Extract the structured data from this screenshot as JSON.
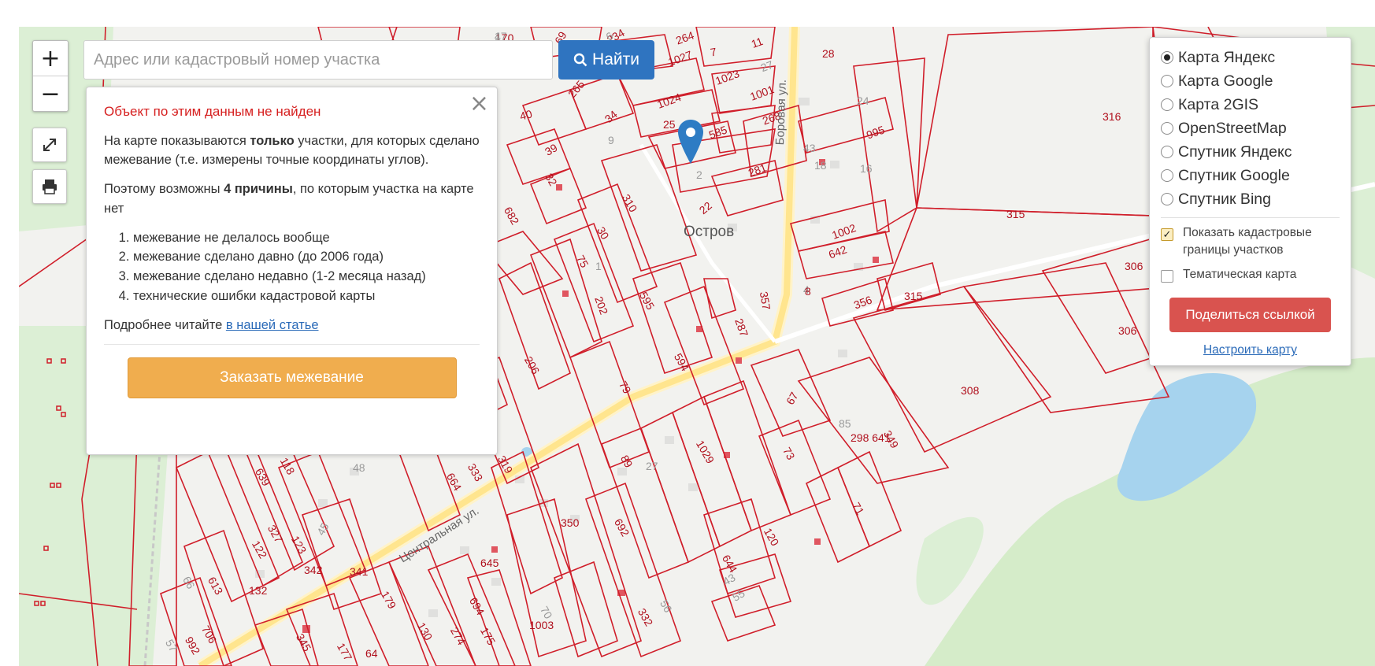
{
  "map": {
    "place_label": "Остров",
    "streets": [
      "Боровая ул.",
      "Центральная ул."
    ],
    "plots": [
      "17",
      "234",
      "264",
      "11",
      "69",
      "7",
      "28",
      "1027",
      "27",
      "1023",
      "1001",
      "1024",
      "268",
      "265",
      "40",
      "34",
      "9",
      "24",
      "316",
      "25",
      "585",
      "995",
      "43",
      "281",
      "18",
      "16",
      "39",
      "2",
      "32",
      "310",
      "22",
      "315",
      "1002",
      "642",
      "682",
      "30",
      "75",
      "1",
      "306",
      "356",
      "315",
      "357",
      "4",
      "306",
      "202",
      "595",
      "287",
      "206",
      "594",
      "308",
      "79",
      "67",
      "298 641",
      "89",
      "1029",
      "73",
      "349",
      "71",
      "48",
      "664",
      "333",
      "319",
      "639",
      "118",
      "27",
      "692",
      "45",
      "327",
      "122",
      "123",
      "120",
      "350",
      "644",
      "645",
      "43",
      "55",
      "341",
      "342",
      "56",
      "66",
      "613",
      "132",
      "694",
      "70",
      "179",
      "332",
      "992",
      "706",
      "345",
      "130",
      "274",
      "1003",
      "175",
      "57",
      "177",
      "64",
      "170",
      "85",
      "8",
      "5",
      "4",
      "6"
    ]
  },
  "zoom": {
    "plus": "+",
    "minus": "−"
  },
  "tools": {
    "fullscreen_icon": "fullscreen-icon",
    "print_icon": "printer-icon"
  },
  "search": {
    "placeholder": "Адрес или кадастровый номер участка",
    "button_label": "Найти"
  },
  "notfound": {
    "error": "Объект по этим данным не найден",
    "p1_a": "На карте показываются ",
    "p1_b": "только",
    "p1_c": " участки, для которых сделано межевание (т.е. измерены точные координаты углов).",
    "p2_a": "Поэтому возможны ",
    "p2_b": "4 причины",
    "p2_c": ", по которым участка на карте нет",
    "reasons": [
      "межевание не делалось вообще",
      "межевание сделано давно (до 2006 года)",
      "межевание сделано недавно (1-2 месяца назад)",
      "технические ошибки кадастровой карты"
    ],
    "more_text": "Подробнее читайте ",
    "more_link": "в нашей статье",
    "order_button": "Заказать межевание"
  },
  "layers": {
    "options": [
      "Карта Яндекс",
      "Карта Google",
      "Карта 2GIS",
      "OpenStreetMap",
      "Спутник Яндекс",
      "Спутник Google",
      "Спутник Bing"
    ],
    "selected": "Карта Яндекс",
    "show_borders": "Показать кадастровые границы участков",
    "thematic": "Тематическая карта",
    "share_button": "Поделиться ссылкой",
    "configure_link": "Настроить карту"
  },
  "colors": {
    "plot_border": "#d01e2a",
    "road": "#ffe699",
    "forest": "#d8efcf",
    "water": "#a6d3ee"
  }
}
